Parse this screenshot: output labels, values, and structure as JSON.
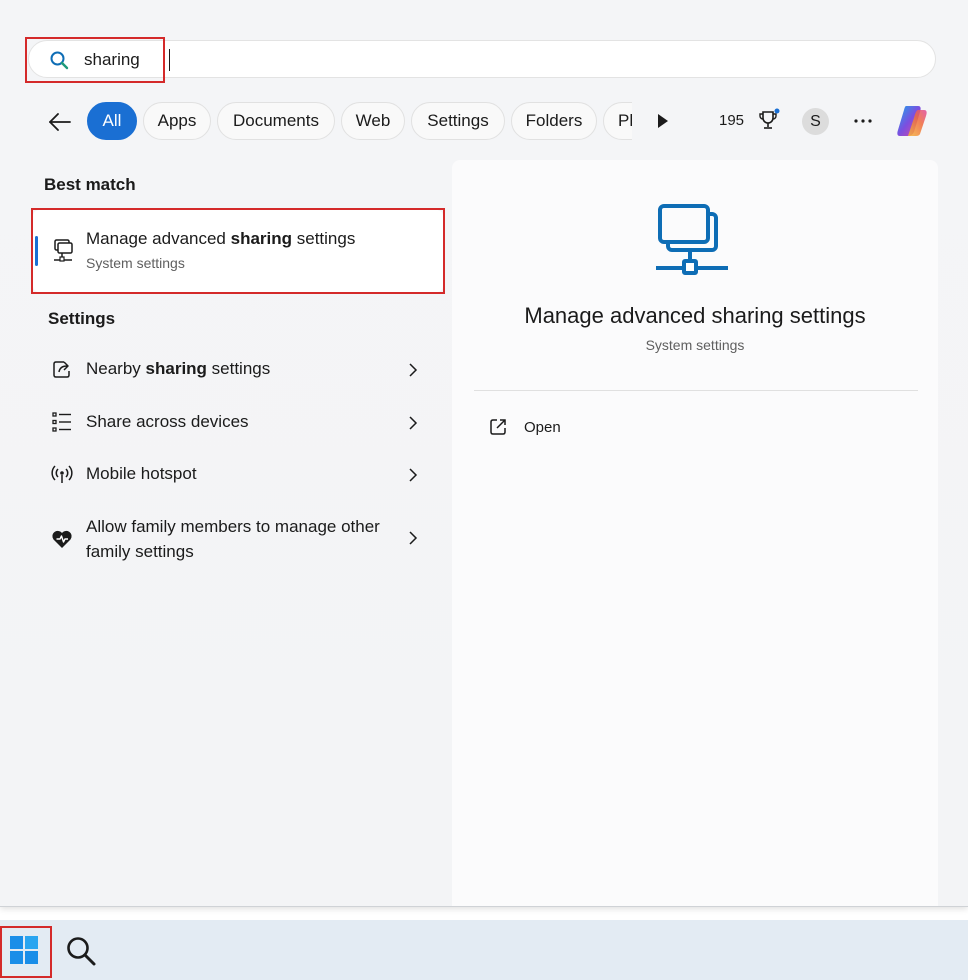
{
  "search": {
    "value": "sharing",
    "icon": "search-icon"
  },
  "filters": {
    "chips": [
      "All",
      "Apps",
      "Documents",
      "Web",
      "Settings",
      "Folders",
      "Ph"
    ],
    "active": "All",
    "points": "195",
    "avatar_letter": "S",
    "accent_color": "#1a6fd3"
  },
  "best_match": {
    "heading": "Best match",
    "title_prefix": "Manage advanced ",
    "title_bold": "sharing",
    "title_suffix": " settings",
    "subtitle": "System settings",
    "icon": "network-computer-icon"
  },
  "settings_section": {
    "heading": "Settings",
    "items": [
      {
        "prefix": "Nearby ",
        "bold": "sharing",
        "suffix": " settings",
        "icon": "share-icon"
      },
      {
        "prefix": "Share across devices",
        "bold": "",
        "suffix": "",
        "icon": "list-icon"
      },
      {
        "prefix": "Mobile hotspot",
        "bold": "",
        "suffix": "",
        "icon": "hotspot-icon"
      },
      {
        "prefix": "Allow family members to manage other family settings",
        "bold": "",
        "suffix": "",
        "icon": "family-heart-icon"
      }
    ]
  },
  "detail": {
    "title": "Manage advanced sharing settings",
    "subtitle": "System settings",
    "action_open": "Open",
    "icon": "shared-network-icon"
  },
  "taskbar": {
    "start_icon": "windows-logo-icon",
    "search_icon": "search-icon"
  },
  "highlight_color": "#d42a2a"
}
